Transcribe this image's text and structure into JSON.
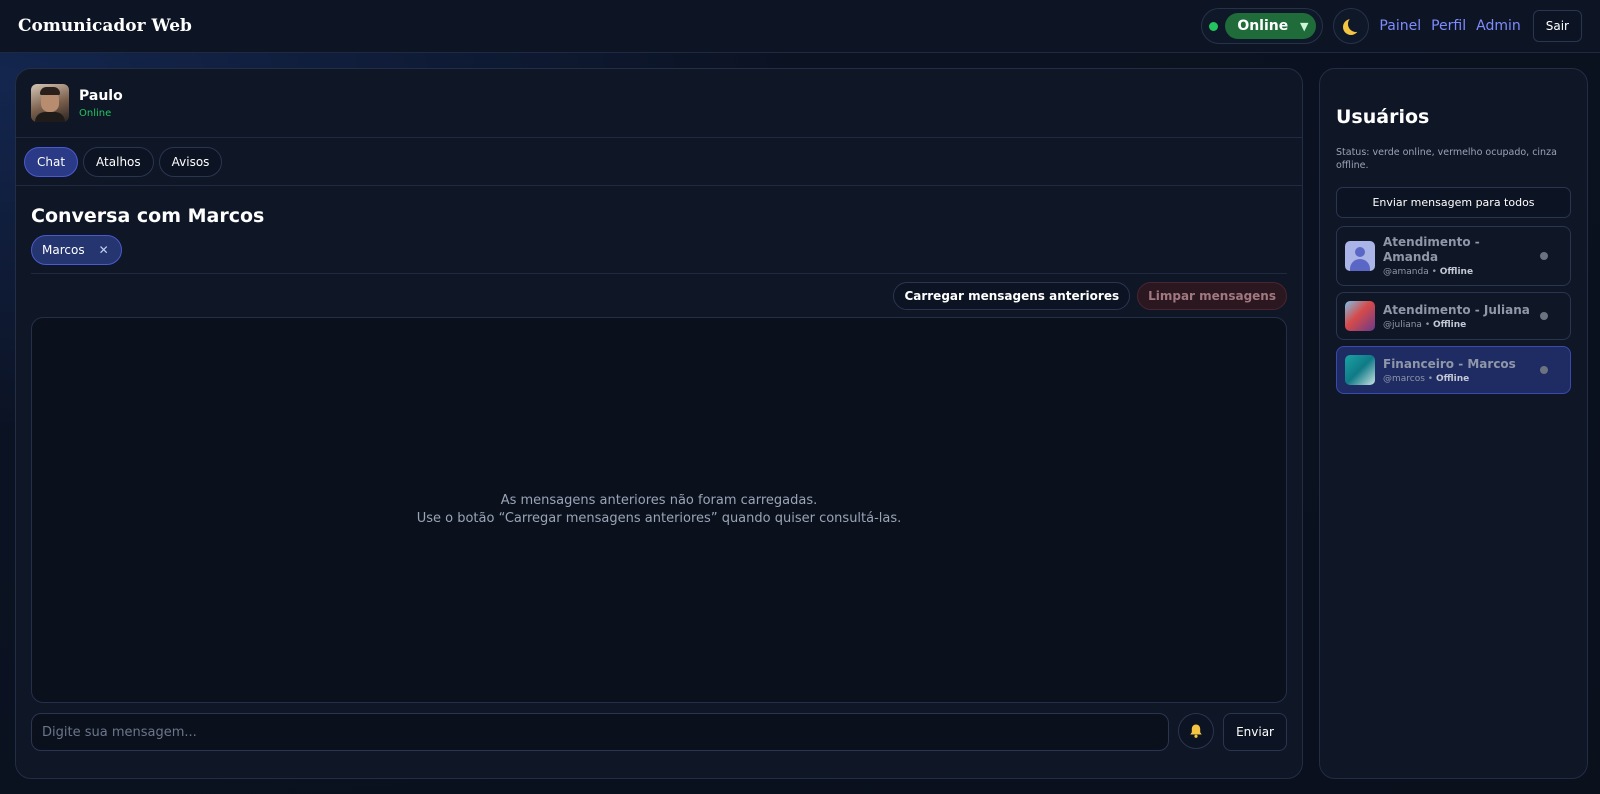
{
  "app": {
    "title": "Comunicador Web"
  },
  "topbar": {
    "status_value": "Online",
    "theme_icon": "moon-icon",
    "links": [
      "Painel",
      "Perfil",
      "Admin"
    ],
    "logout_label": "Sair"
  },
  "current_user": {
    "name": "Paulo",
    "status": "Online"
  },
  "tabs": [
    {
      "label": "Chat",
      "active": true
    },
    {
      "label": "Atalhos",
      "active": false
    },
    {
      "label": "Avisos",
      "active": false
    }
  ],
  "conversation": {
    "title": "Conversa com Marcos",
    "chip": "Marcos",
    "load_button": "Carregar mensagens anteriores",
    "clear_button": "Limpar mensagens",
    "empty_line1": "As mensagens anteriores não foram carregadas.",
    "empty_line2": "Use o botão “Carregar mensagens anteriores” quando quiser consultá-las.",
    "input_placeholder": "Digite sua mensagem...",
    "send_label": "Enviar"
  },
  "sidebar": {
    "title": "Usuários",
    "note": "Status: verde online, vermelho ocupado, cinza offline.",
    "broadcast_label": "Enviar mensagem para todos",
    "users": [
      {
        "name": "Atendimento - Amanda",
        "handle": "@amanda",
        "status": "Offline"
      },
      {
        "name": "Atendimento - Juliana",
        "handle": "@juliana",
        "status": "Offline"
      },
      {
        "name": "Financeiro - Marcos",
        "handle": "@marcos",
        "status": "Offline"
      }
    ]
  },
  "colors": {
    "accent": "#7e8cff",
    "online": "#22c55e",
    "offline": "#6b7280"
  }
}
